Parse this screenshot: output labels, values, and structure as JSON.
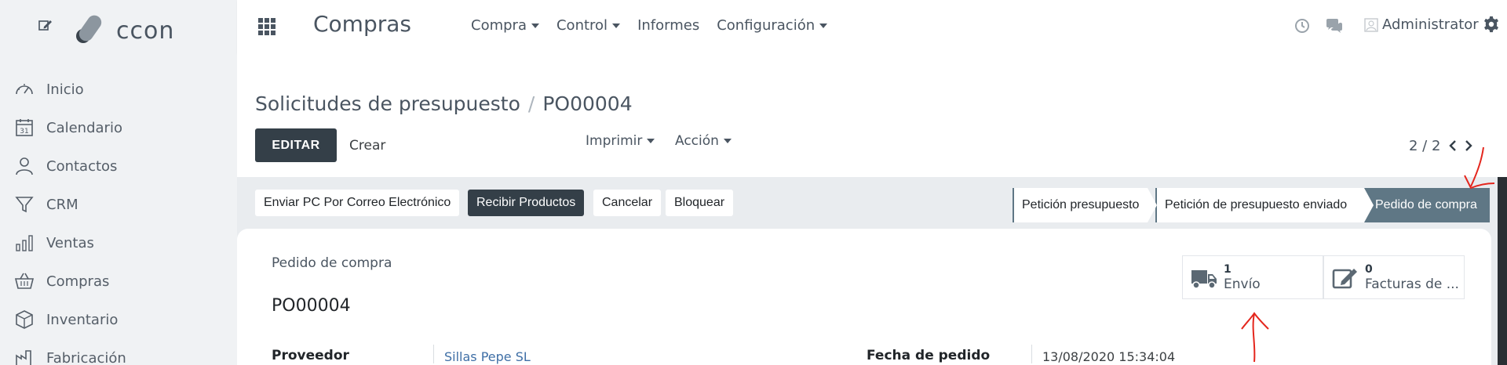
{
  "sidebar": {
    "brand_text": "ccon",
    "items": [
      {
        "label": "Inicio",
        "icon": "gauge-icon"
      },
      {
        "label": "Calendario",
        "icon": "calendar-icon",
        "icon_text": "31"
      },
      {
        "label": "Contactos",
        "icon": "person-icon"
      },
      {
        "label": "CRM",
        "icon": "funnel-icon"
      },
      {
        "label": "Ventas",
        "icon": "bar-chart-icon"
      },
      {
        "label": "Compras",
        "icon": "basket-icon"
      },
      {
        "label": "Inventario",
        "icon": "box-icon"
      },
      {
        "label": "Fabricación",
        "icon": "factory-icon"
      }
    ]
  },
  "topbar": {
    "app_title": "Compras",
    "nav": [
      {
        "label": "Compra",
        "dropdown": true
      },
      {
        "label": "Control",
        "dropdown": true
      },
      {
        "label": "Informes",
        "dropdown": false
      },
      {
        "label": "Configuración",
        "dropdown": true
      }
    ],
    "user": "Administrator"
  },
  "control": {
    "breadcrumb_parent": "Solicitudes de presupuesto",
    "breadcrumb_sep": "/",
    "breadcrumb_current": "PO00004",
    "edit_label": "EDITAR",
    "create_label": "Crear",
    "print_label": "Imprimir",
    "action_label": "Acción",
    "pager": "2 / 2"
  },
  "statusbar": {
    "buttons": [
      {
        "label": "Enviar PC Por Correo Electrónico",
        "style": "light"
      },
      {
        "label": "Recibir Productos",
        "style": "dark"
      },
      {
        "label": "Cancelar",
        "style": "light"
      },
      {
        "label": "Bloquear",
        "style": "light"
      }
    ],
    "stages": [
      {
        "label": "Petición presupuesto",
        "active": false
      },
      {
        "label": "Petición de presupuesto enviado",
        "active": false
      },
      {
        "label": "Pedido de compra",
        "active": true
      }
    ]
  },
  "sheet": {
    "doc_label": "Pedido de compra",
    "doc_name": "PO00004",
    "smart_buttons": [
      {
        "count": "1",
        "label": "Envío",
        "icon": "truck-icon"
      },
      {
        "count": "0",
        "label": "Facturas de ...",
        "icon": "pencil-square-icon"
      }
    ],
    "fields": {
      "supplier_label": "Proveedor",
      "supplier_value": "Sillas Pepe SL",
      "date_label": "Fecha de pedido",
      "date_value": "13/08/2020 15:34:04"
    }
  },
  "colors": {
    "sidebar_bg": "#f0f2f4",
    "dark_button": "#343f48",
    "active_stage": "#5f7785",
    "link": "#3f6fa6",
    "annotation": "#e4261d"
  }
}
